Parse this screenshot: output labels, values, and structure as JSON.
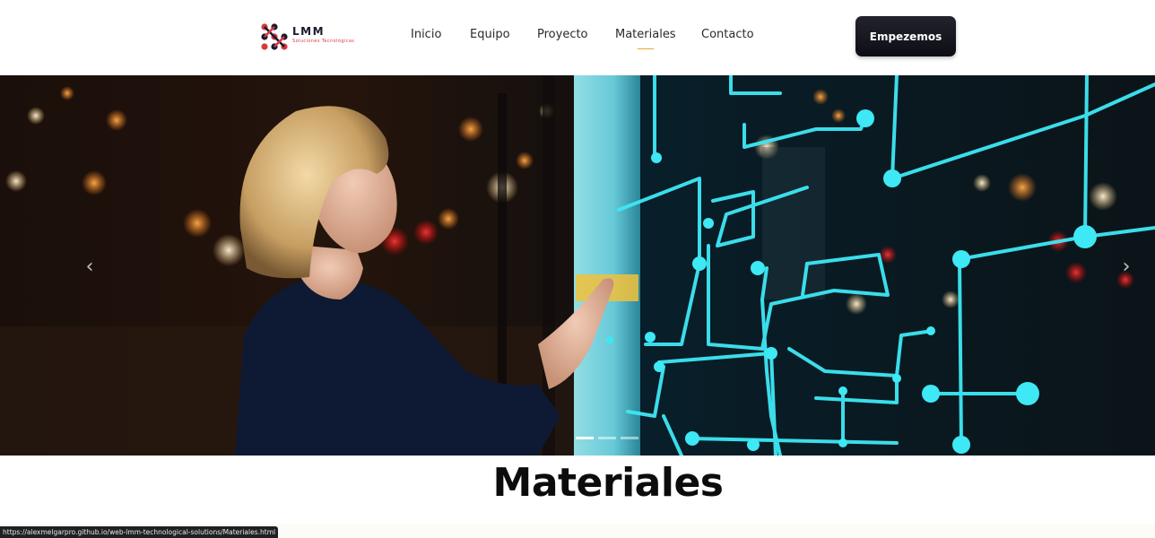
{
  "brand": {
    "name": "LMM",
    "tagline": "Soluciones Tecnológicas",
    "logo_icon": "lmm-logo-icon",
    "colors": {
      "primary_dark": "#1a1a2e",
      "accent_red": "#d9383a"
    }
  },
  "nav": {
    "items": [
      {
        "label": "Inicio",
        "active": false
      },
      {
        "label": "Equipo",
        "active": false
      },
      {
        "label": "Proyecto",
        "active": false
      },
      {
        "label": "Materiales",
        "active": true
      },
      {
        "label": "Contacto",
        "active": false
      }
    ],
    "active_underline_color": "#f0a030",
    "cta_label": "Empezemos"
  },
  "carousel": {
    "prev_icon": "chevron-left-icon",
    "prev_glyph": "‹",
    "next_icon": "chevron-right-icon",
    "next_glyph": "›",
    "indicator_count": 3,
    "active_index": 0,
    "image_subject": "woman-touching-digital-screen-circuit-lines",
    "circuit_color": "#3ee8f5"
  },
  "section": {
    "title": "Materiales"
  },
  "status_bar": {
    "url": "https://alexmelgarpro.github.io/web-lmm-technological-solutions/Materiales.html"
  }
}
